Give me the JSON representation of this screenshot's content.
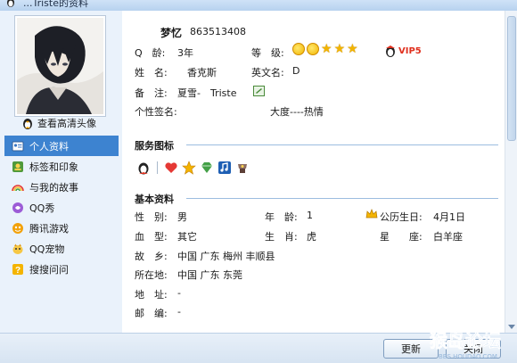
{
  "window": {
    "title_partial": "...Triste的资料"
  },
  "sidebar": {
    "view_hd_avatar": "查看高清头像",
    "items": [
      {
        "label": "个人资料",
        "icon": "profile-card-icon",
        "active": true
      },
      {
        "label": "标签和印象",
        "icon": "tag-icon",
        "active": false
      },
      {
        "label": "与我的故事",
        "icon": "rainbow-icon",
        "active": false
      },
      {
        "label": "QQ秀",
        "icon": "qq-show-icon",
        "active": false
      },
      {
        "label": "腾讯游戏",
        "icon": "game-icon",
        "active": false
      },
      {
        "label": "QQ宠物",
        "icon": "pet-icon",
        "active": false
      },
      {
        "label": "搜搜问问",
        "icon": "question-icon",
        "active": false
      }
    ]
  },
  "profile": {
    "nickname": "梦忆",
    "qq_number": "863513408",
    "age_label": "Q　龄:",
    "age_value": "3年",
    "level_label": "等　级:",
    "level_icons": [
      "sun",
      "sun",
      "star",
      "star",
      "star"
    ],
    "vip_label": "VIP5",
    "name_label": "姓　名:",
    "name_value": "香克斯",
    "english_name_label": "英文名:",
    "english_name_value": "D",
    "remark_label": "备　注:",
    "remark_value": "夏雪-　Triste",
    "signature_label": "个性签名:",
    "signature_value": "大度----热情"
  },
  "services": {
    "title": "服务图标",
    "icons": [
      "qq-penguin-icon",
      "heart-icon",
      "star-badge-icon",
      "diamond-icon",
      "music-icon",
      "game-pad-icon"
    ]
  },
  "basic": {
    "title": "基本资料",
    "gender_label": "性　别:",
    "gender_value": "男",
    "age_label": "年　龄:",
    "age_value": "1",
    "birthday_label": "公历生日:",
    "birthday_value": "4月1日",
    "blood_label": "血　型:",
    "blood_value": "其它",
    "zodiac_label": "生　肖:",
    "zodiac_value": "虎",
    "constellation_label": "星　　座:",
    "constellation_value": "白羊座",
    "hometown_label": "故　乡:",
    "hometown_value": "中国 广东 梅州 丰顺县",
    "location_label": "所在地:",
    "location_value": "中国 广东 东莞",
    "address_label": "地　址:",
    "address_value": "-",
    "zip_label": "邮　编:",
    "zip_value": "-"
  },
  "buttons": {
    "refresh": "更新",
    "close": "关闭"
  },
  "watermark": {
    "main": "猴岛论坛",
    "sub": "BBS.HOUDAO.COM"
  },
  "colors": {
    "accent": "#3d83d0",
    "section_line": "#9cbde0",
    "vip": "#e0301e"
  }
}
